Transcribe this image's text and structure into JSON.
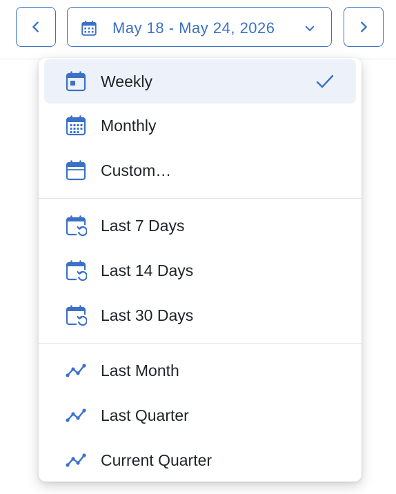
{
  "toolbar": {
    "date_range": "May 18 - May 24, 2026"
  },
  "menu": {
    "selected": "Weekly",
    "groups": [
      {
        "items": [
          {
            "label": "Weekly",
            "icon": "calendar-day-icon"
          },
          {
            "label": "Monthly",
            "icon": "calendar-grid-icon"
          },
          {
            "label": "Custom…",
            "icon": "calendar-icon"
          }
        ]
      },
      {
        "items": [
          {
            "label": "Last 7 Days",
            "icon": "calendar-history-icon"
          },
          {
            "label": "Last 14 Days",
            "icon": "calendar-history-icon"
          },
          {
            "label": "Last 30 Days",
            "icon": "calendar-history-icon"
          }
        ]
      },
      {
        "items": [
          {
            "label": "Last Month",
            "icon": "trend-line-icon"
          },
          {
            "label": "Last Quarter",
            "icon": "trend-line-icon"
          },
          {
            "label": "Current Quarter",
            "icon": "trend-line-icon"
          }
        ]
      }
    ]
  },
  "colors": {
    "accent": "#3b71c7",
    "selected_bg": "#edf2fa",
    "text": "#1f2328",
    "divider": "#e3e5e8"
  }
}
